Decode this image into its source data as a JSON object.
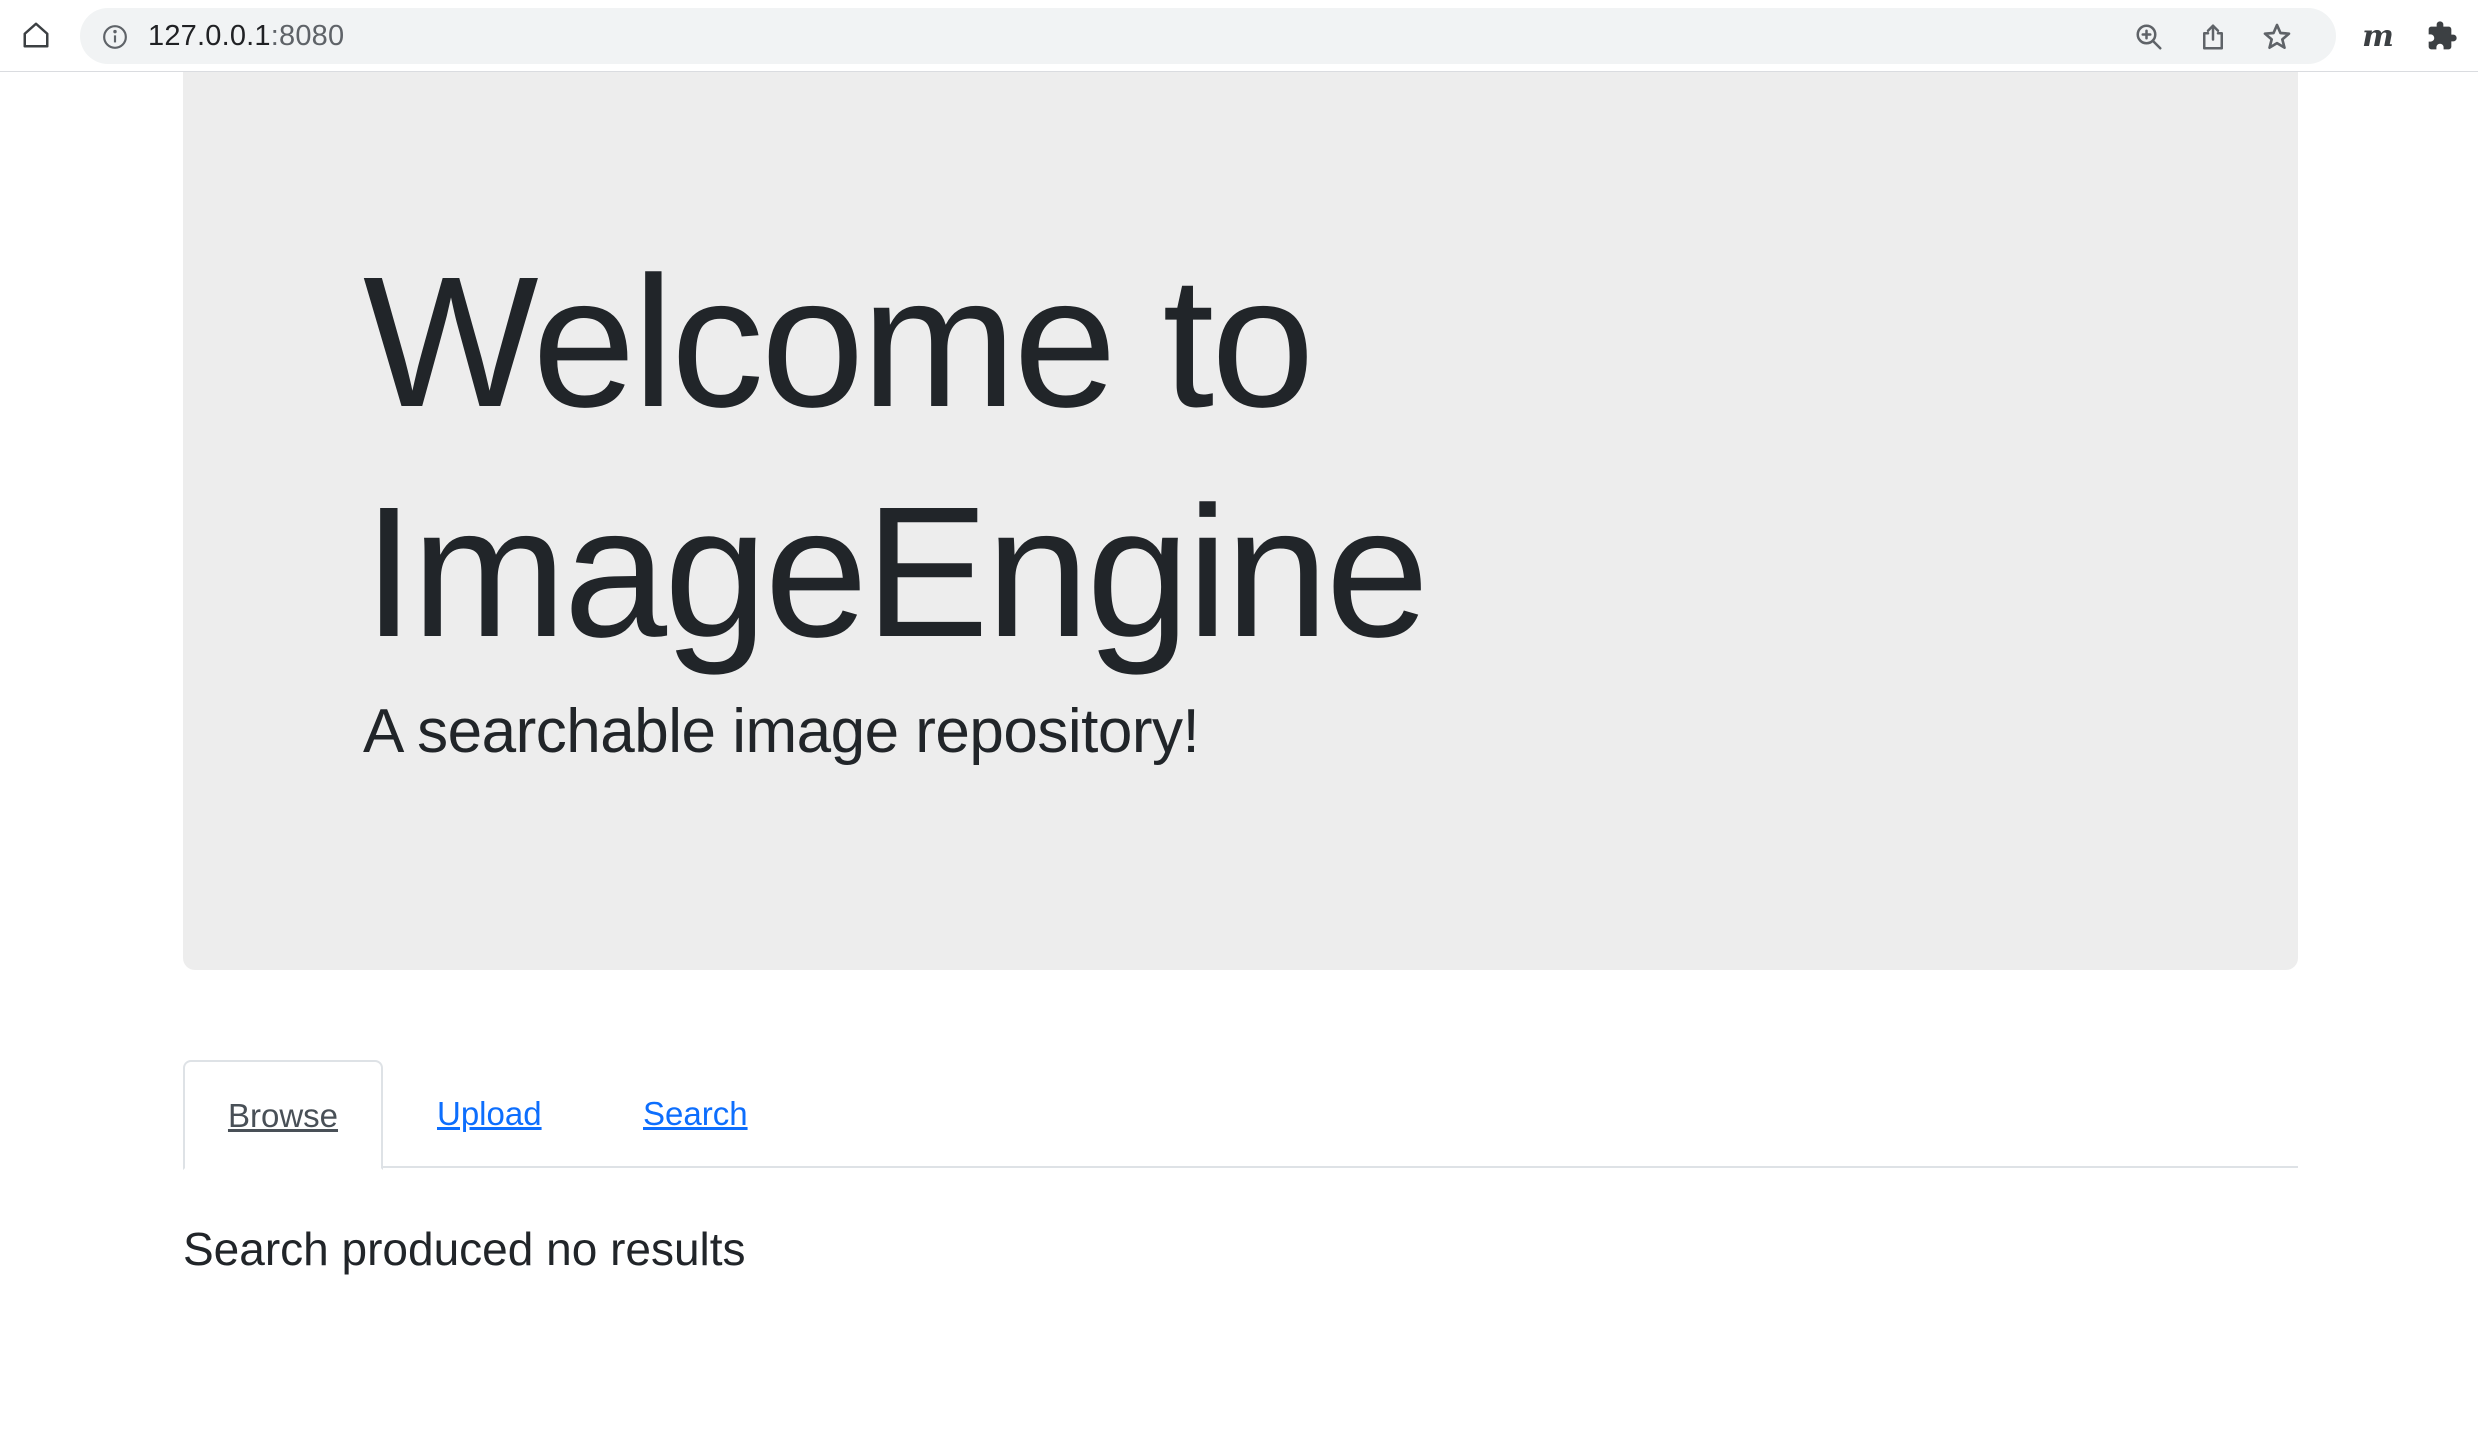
{
  "browser": {
    "url_host": "127.0.0.1",
    "url_port": ":8080",
    "extension_label": "m"
  },
  "jumbotron": {
    "title": "Welcome to ImageEngine",
    "lead": "A searchable image repository!"
  },
  "tabs": [
    {
      "label": "Browse",
      "active": true
    },
    {
      "label": "Upload",
      "active": false
    },
    {
      "label": "Search",
      "active": false
    }
  ],
  "result": {
    "message": "Search produced no results"
  },
  "colors": {
    "jumbotron_bg": "#ededed",
    "link": "#0d6efd",
    "text": "#212529"
  }
}
